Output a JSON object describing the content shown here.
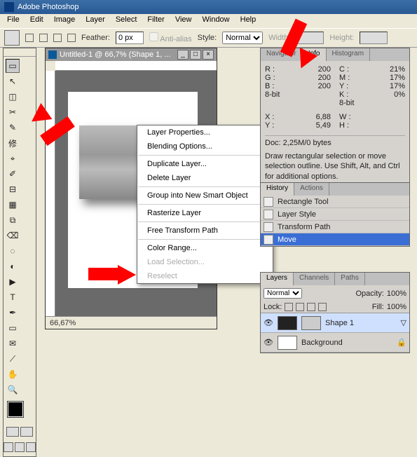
{
  "app": {
    "title": "Adobe Photoshop"
  },
  "menu": [
    "File",
    "Edit",
    "Image",
    "Layer",
    "Select",
    "Filter",
    "View",
    "Window",
    "Help"
  ],
  "options": {
    "feather_label": "Feather:",
    "feather_value": "0 px",
    "antialias": "Anti-alias",
    "style_label": "Style:",
    "style_value": "Normal",
    "width_label": "Width:",
    "height_label": "Height:"
  },
  "doc": {
    "title": "Untitled-1 @ 66,7% (Shape 1, ...",
    "zoom": "66,67%"
  },
  "context_menu": [
    {
      "label": "Layer Properties...",
      "d": false
    },
    {
      "label": "Blending Options...",
      "d": false
    },
    {
      "sep": true
    },
    {
      "label": "Duplicate Layer...",
      "d": false
    },
    {
      "label": "Delete Layer",
      "d": false
    },
    {
      "sep": true
    },
    {
      "label": "Group into New Smart Object",
      "d": false
    },
    {
      "sep": true
    },
    {
      "label": "Rasterize Layer",
      "d": false
    },
    {
      "sep": true
    },
    {
      "label": "Free Transform Path",
      "d": false
    },
    {
      "sep": true
    },
    {
      "label": "Color Range...",
      "d": false
    },
    {
      "label": "Load Selection...",
      "d": true
    },
    {
      "label": "Reselect",
      "d": true
    }
  ],
  "info_panel": {
    "tabs": [
      "Navigator",
      "Info",
      "Histogram"
    ],
    "rgb": {
      "R": "200",
      "G": "200",
      "B": "200"
    },
    "cmyk": {
      "C": "21%",
      "M": "17%",
      "Y": "17%",
      "K": "0%"
    },
    "mode_a": "8-bit",
    "mode_b": "8-bit",
    "xy": {
      "X": "6,88",
      "Y": "5,49"
    },
    "wh": {
      "W": "",
      "H": ""
    },
    "docsize": "Doc: 2,25M/0 bytes",
    "hint": "Draw rectangular selection or move selection outline.  Use Shift, Alt, and Ctrl for additional options."
  },
  "history_panel": {
    "tabs": [
      "History",
      "Actions"
    ],
    "items": [
      "Rectangle Tool",
      "Layer Style",
      "Transform Path",
      "Move"
    ],
    "active": 3
  },
  "layers_panel": {
    "tabs": [
      "Layers",
      "Channels",
      "Paths"
    ],
    "blend": "Normal",
    "opacity_label": "Opacity:",
    "opacity": "100%",
    "lock_label": "Lock:",
    "fill_label": "Fill:",
    "fill": "100%",
    "layers": [
      {
        "name": "Shape 1",
        "active": true,
        "dark": true,
        "has_effects": true
      },
      {
        "name": "Background",
        "active": false,
        "dark": false,
        "locked": true
      }
    ]
  },
  "tools": {
    "icons": [
      "▭",
      "↖",
      "◫",
      "✂",
      "✎",
      "修",
      "⌖",
      "✐",
      "⊟",
      "▦",
      "⧉",
      "⌫",
      "T",
      "◺",
      "▭",
      "✥",
      "◔",
      "◰",
      "🔍",
      "✋"
    ]
  }
}
